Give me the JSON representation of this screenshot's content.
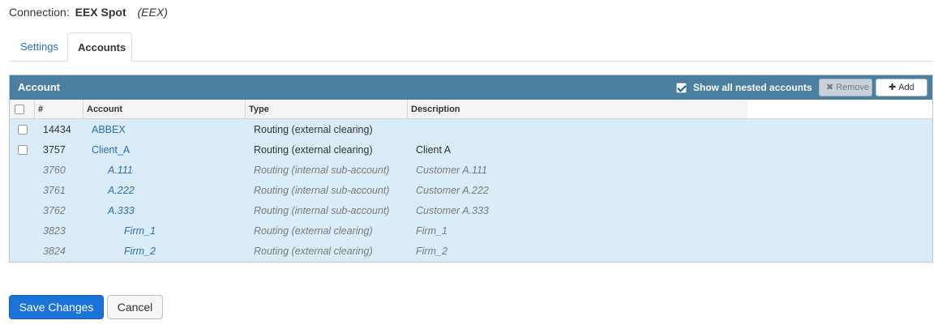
{
  "connection": {
    "label": "Connection:",
    "name": "EEX Spot",
    "code": "(EEX)"
  },
  "tabs": [
    {
      "label": "Settings"
    },
    {
      "label": "Accounts"
    }
  ],
  "panel": {
    "title": "Account",
    "show_nested_label": "Show all nested accounts",
    "show_nested_checked": true,
    "remove_label": "Remove",
    "add_label": "Add"
  },
  "columns": {
    "id": "#",
    "account": "Account",
    "type": "Type",
    "description": "Description"
  },
  "rows": [
    {
      "id": "14434",
      "account": "ABBEX",
      "type": "Routing (external clearing)",
      "description": ""
    },
    {
      "id": "3757",
      "account": "Client_A",
      "type": "Routing (external clearing)",
      "description": "Client A"
    },
    {
      "id": "3760",
      "account": "A.111",
      "type": "Routing (internal sub-account)",
      "description": "Customer A.111"
    },
    {
      "id": "3761",
      "account": "A.222",
      "type": "Routing (internal sub-account)",
      "description": "Customer A.222"
    },
    {
      "id": "3762",
      "account": "A.333",
      "type": "Routing (internal sub-account)",
      "description": "Customer A.333"
    },
    {
      "id": "3823",
      "account": "Firm_1",
      "type": "Routing (external clearing)",
      "description": "Firm_1"
    },
    {
      "id": "3824",
      "account": "Firm_2",
      "type": "Routing (external clearing)",
      "description": "Firm_2"
    }
  ],
  "footer": {
    "save_label": "Save Changes",
    "cancel_label": "Cancel"
  },
  "colors": {
    "panel_header": "#4a7f9f",
    "panel_body": "#daecf7",
    "primary": "#1a73d9",
    "link": "#2a6fb5"
  }
}
